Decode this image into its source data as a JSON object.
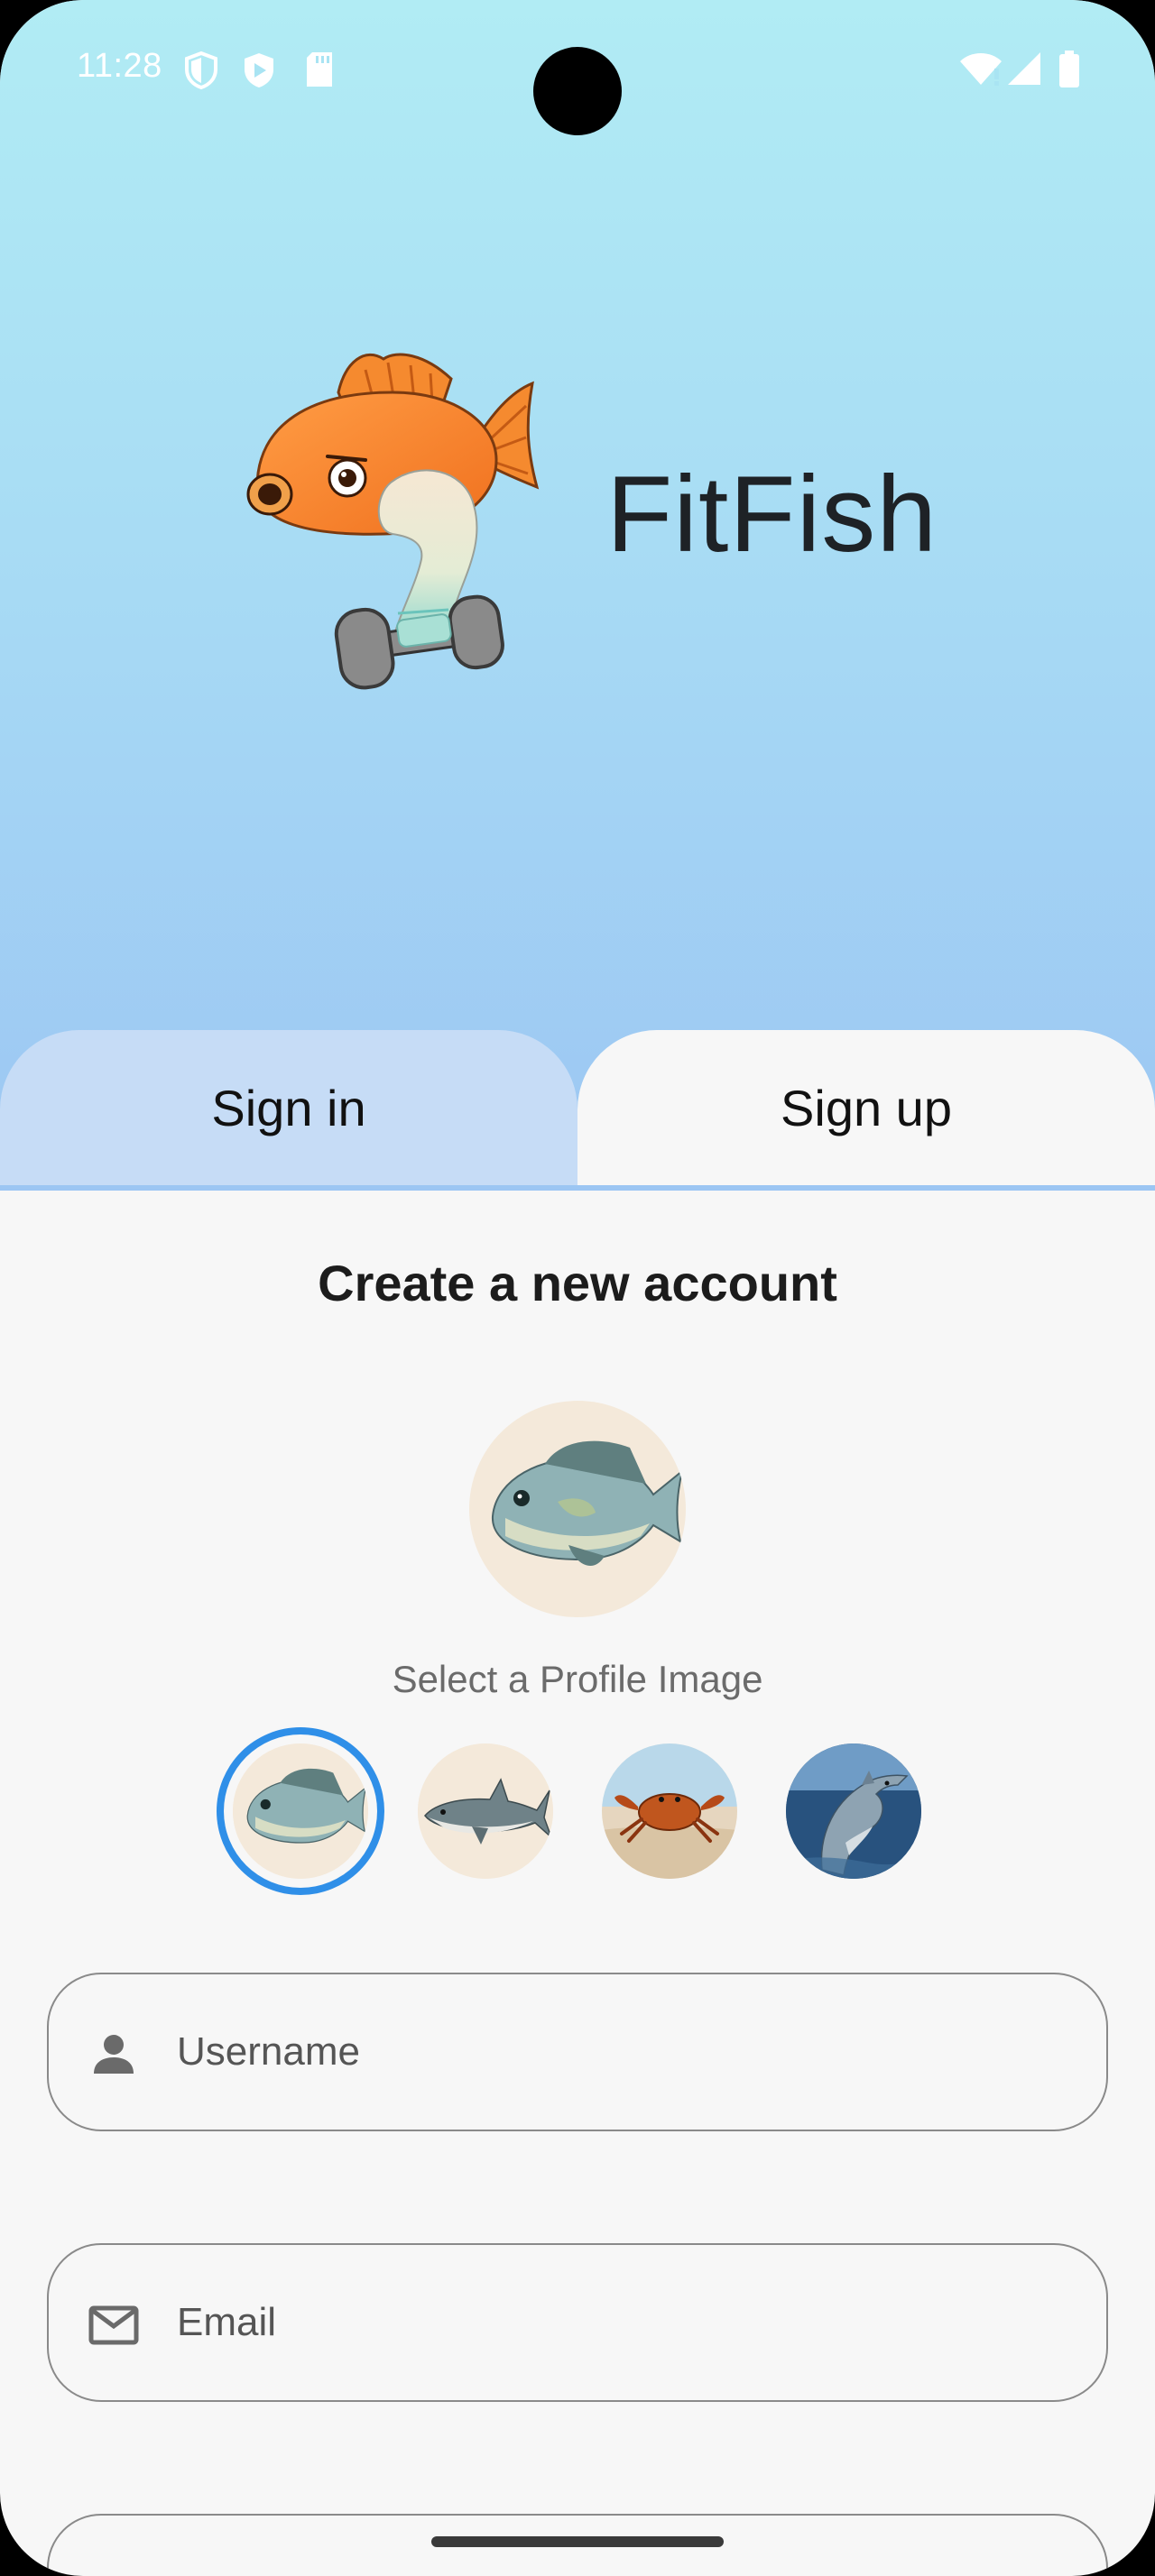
{
  "status_bar": {
    "time": "11:28",
    "left_icons": [
      "shield-icon",
      "play-protect-icon",
      "sd-card-icon"
    ],
    "right_icons": [
      "wifi-alert-icon",
      "signal-icon",
      "battery-icon"
    ]
  },
  "app": {
    "name": "FitFish",
    "logo": "fitfish-logo-icon"
  },
  "tabs": [
    {
      "label": "Sign in",
      "active": false
    },
    {
      "label": "Sign up",
      "active": true
    }
  ],
  "signup": {
    "title": "Create a new account",
    "profile_image_label": "Select a Profile Image",
    "profile_options": [
      "bluegill-fish",
      "shark",
      "crab",
      "dolphin"
    ],
    "selected_option": 0
  },
  "fields": {
    "username": {
      "placeholder": "Username",
      "icon": "person-icon"
    },
    "email": {
      "placeholder": "Email",
      "icon": "mail-icon"
    }
  },
  "colors": {
    "hero_top": "#b1ecf4",
    "hero_bottom": "#9cc6f3",
    "inactive_tab": "#c6dcf6",
    "sheet_bg": "#f7f7f7",
    "selection_ring": "#2f8fe8"
  }
}
